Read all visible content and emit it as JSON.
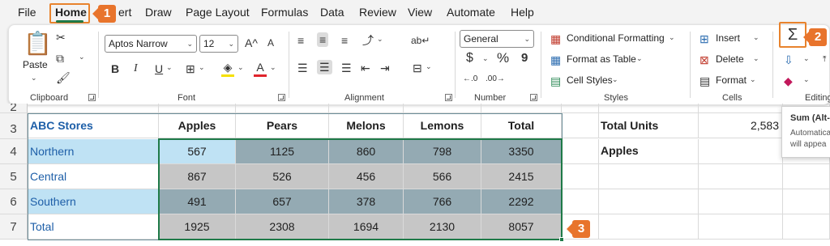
{
  "menu": {
    "tabs": [
      "File",
      "Home",
      "ert",
      "Draw",
      "Page Layout",
      "Formulas",
      "Data",
      "Review",
      "View",
      "Automate",
      "Help"
    ],
    "active_tab": "Home"
  },
  "callouts": [
    "1",
    "2",
    "3"
  ],
  "ribbon": {
    "clipboard": {
      "paste_label": "Paste",
      "group_label": "Clipboard"
    },
    "font": {
      "font_name": "Aptos Narrow",
      "font_size": "12",
      "grow_label": "A^",
      "shrink_label": "A",
      "bold": "B",
      "italic": "I",
      "underline": "U",
      "font_color_letter": "A",
      "group_label": "Font"
    },
    "alignment": {
      "group_label": "Alignment"
    },
    "number": {
      "format": "General",
      "currency": "$",
      "percent": "%",
      "comma": "9",
      "group_label": "Number"
    },
    "styles": {
      "conditional": "Conditional Formatting",
      "format_table": "Format as Table",
      "cell_styles": "Cell Styles",
      "group_label": "Styles"
    },
    "cells": {
      "insert": "Insert",
      "delete": "Delete",
      "format": "Format",
      "group_label": "Cells"
    },
    "editing": {
      "sum_symbol": "Σ",
      "group_label": "Editing"
    }
  },
  "tooltip": {
    "title": "Sum (Alt-",
    "line1": "Automatica",
    "line2": "will appea"
  },
  "sheet": {
    "row_numbers": [
      "2",
      "3",
      "4",
      "5",
      "6",
      "7"
    ],
    "headers": [
      "ABC Stores",
      "Apples",
      "Pears",
      "Melons",
      "Lemons",
      "Total"
    ],
    "rows": [
      {
        "store": "Northern",
        "values": [
          "567",
          "1125",
          "860",
          "798",
          "3350"
        ]
      },
      {
        "store": "Central",
        "values": [
          "867",
          "526",
          "456",
          "566",
          "2415"
        ]
      },
      {
        "store": "Southern",
        "values": [
          "491",
          "657",
          "378",
          "766",
          "2292"
        ]
      },
      {
        "store": "Total",
        "values": [
          "1925",
          "2308",
          "1694",
          "2130",
          "8057"
        ]
      }
    ],
    "side_label": "Total Units Apples",
    "side_value": "2,583"
  },
  "colors": {
    "accent_orange": "#e8742c",
    "excel_green": "#1f7a48",
    "blue_fill": "#bfe2f4",
    "dark_fill": "#94aab3",
    "gray_fill": "#c6c6c6"
  }
}
